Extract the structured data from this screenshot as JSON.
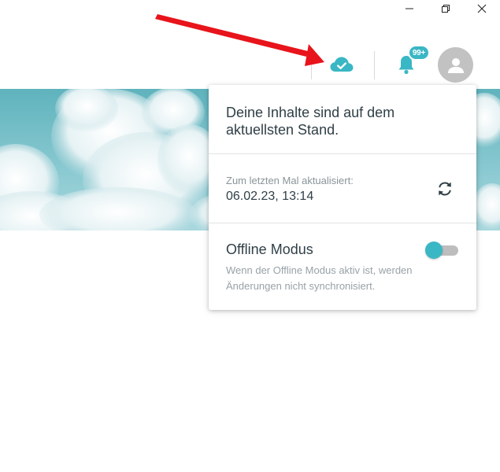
{
  "window": {
    "controls": [
      "minimize",
      "restore",
      "close"
    ]
  },
  "header": {
    "sync_icon": "cloud-check-icon",
    "notifications": {
      "icon": "bell-icon",
      "badge": "99+"
    },
    "avatar_icon": "user-icon"
  },
  "sync_popup": {
    "status_text": "Deine Inhalte sind auf dem aktuellsten Stand.",
    "last_update_label": "Zum letzten Mal aktualisiert:",
    "last_update_value": "06.02.23, 13:14",
    "refresh_icon": "refresh-icon",
    "offline": {
      "title": "Offline Modus",
      "description": "Wenn der Offline Modus aktiv ist, werden Änderungen nicht synchronisiert.",
      "enabled": false
    }
  },
  "colors": {
    "accent": "#3ab7c4",
    "text_dark": "#2f3f46",
    "text_muted": "#8a9499",
    "avatar_bg": "#c2c2c2",
    "annotation_arrow": "#e8141b"
  }
}
